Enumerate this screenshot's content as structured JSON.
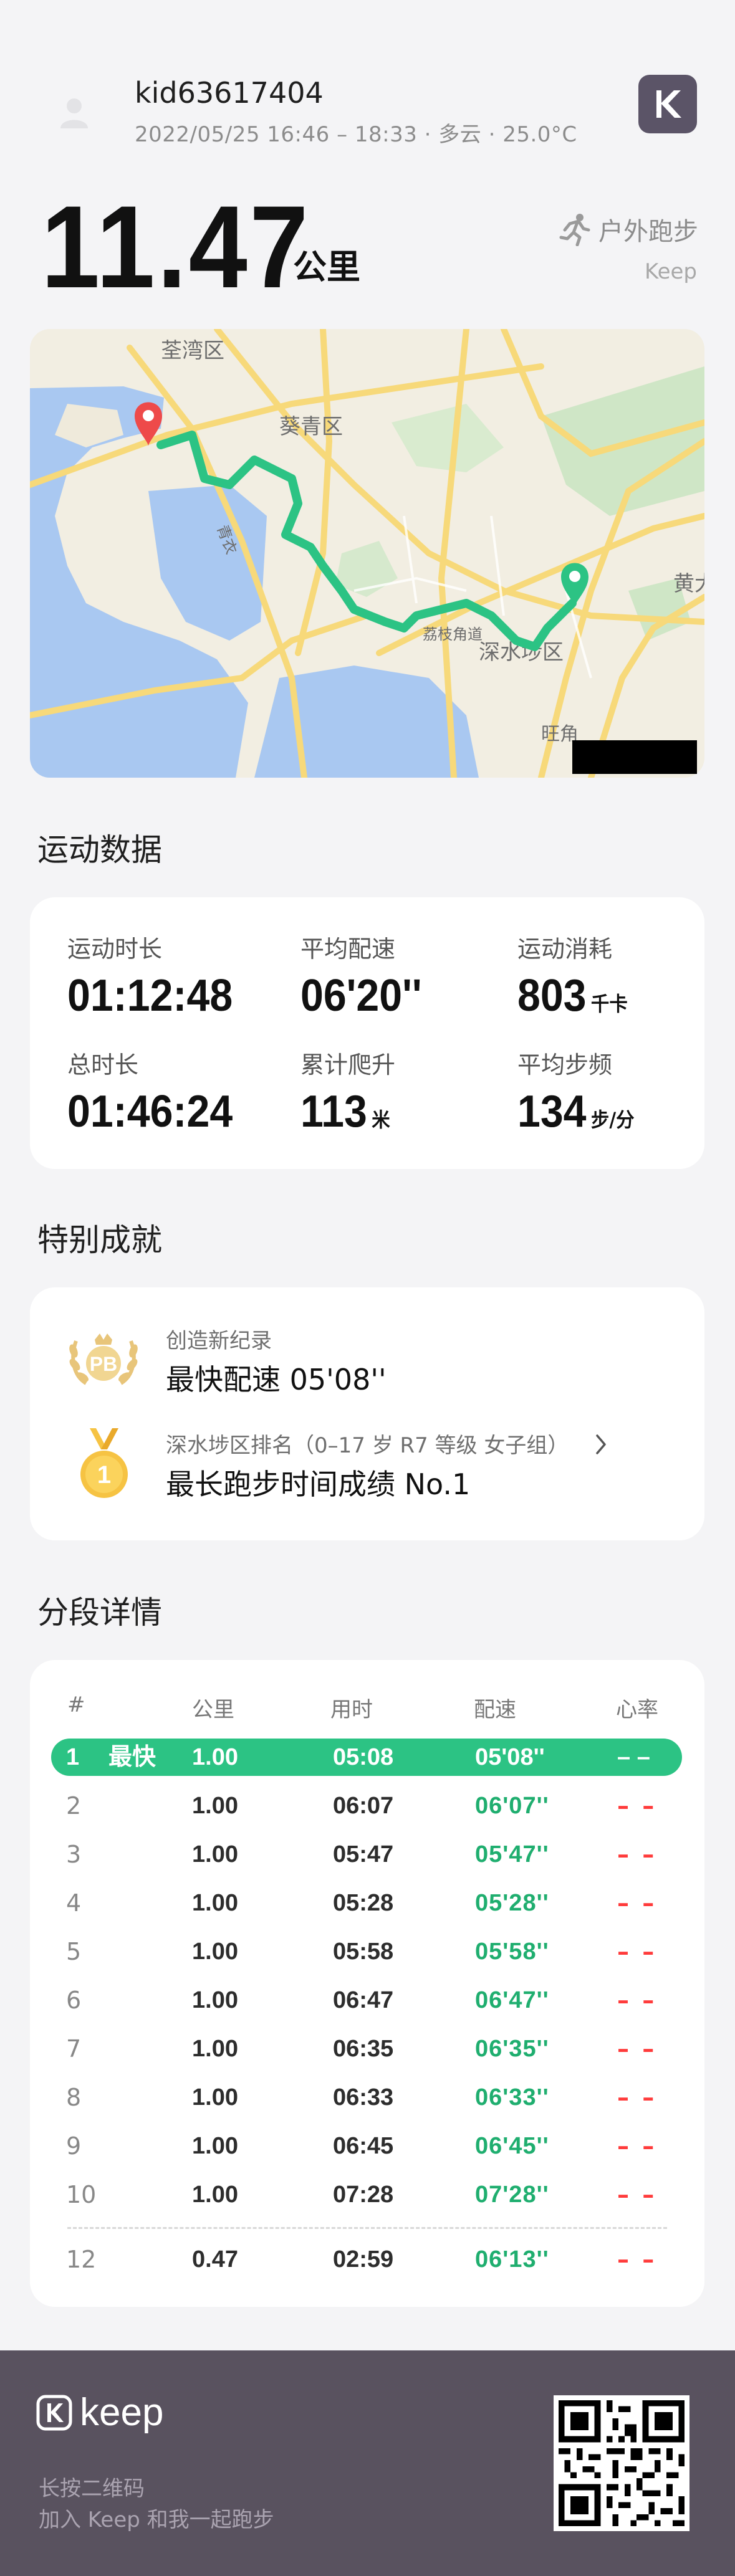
{
  "header": {
    "username": "kid63617404",
    "meta": "2022/05/25 16:46 – 18:33 · 多云 · 25.0°C",
    "logo_icon": "keep-k-logo-icon"
  },
  "summary": {
    "distance": "11.47",
    "distance_unit": "公里",
    "sport_type": "户外跑步",
    "brand": "Keep"
  },
  "map": {
    "labels": [
      "荃湾区",
      "葵青区",
      "黄大",
      "深水埗区",
      "旺角",
      "青衣",
      "荔枝角道"
    ],
    "route_color": "#2cc384",
    "start_pin_color": "#ee4a4a",
    "end_pin_color": "#2cc384"
  },
  "sections": {
    "stats_title": "运动数据",
    "achievements_title": "特别成就",
    "splits_title": "分段详情"
  },
  "stats": [
    {
      "label": "运动时长",
      "value": "01:12:48",
      "unit": ""
    },
    {
      "label": "平均配速",
      "value": "06'20''",
      "unit": ""
    },
    {
      "label": "运动消耗",
      "value": "803",
      "unit": "千卡"
    },
    {
      "label": "总时长",
      "value": "01:46:24",
      "unit": ""
    },
    {
      "label": "累计爬升",
      "value": "113",
      "unit": "米"
    },
    {
      "label": "平均步频",
      "value": "134",
      "unit": "步/分"
    }
  ],
  "achievements": [
    {
      "icon": "pb-laurel-icon",
      "badge_text": "PB",
      "sub": "创造新纪录",
      "main": "最快配速 05'08''"
    },
    {
      "icon": "gold-medal-icon",
      "badge_text": "1",
      "sub": "深水埗区排名（0–17 岁 R7 等级 女子组）",
      "main": "最长跑步时间成绩 No.1"
    }
  ],
  "splits": {
    "headers": [
      "#",
      "公里",
      "用时",
      "配速",
      "心率"
    ],
    "rows": [
      {
        "n": "1",
        "tag": "最快",
        "km": "1.00",
        "time": "05:08",
        "pace": "05'08''",
        "hr": "– –"
      },
      {
        "n": "2",
        "tag": "",
        "km": "1.00",
        "time": "06:07",
        "pace": "06'07''",
        "hr": "– –"
      },
      {
        "n": "3",
        "tag": "",
        "km": "1.00",
        "time": "05:47",
        "pace": "05'47''",
        "hr": "– –"
      },
      {
        "n": "4",
        "tag": "",
        "km": "1.00",
        "time": "05:28",
        "pace": "05'28''",
        "hr": "– –"
      },
      {
        "n": "5",
        "tag": "",
        "km": "1.00",
        "time": "05:58",
        "pace": "05'58''",
        "hr": "– –"
      },
      {
        "n": "6",
        "tag": "",
        "km": "1.00",
        "time": "06:47",
        "pace": "06'47''",
        "hr": "– –"
      },
      {
        "n": "7",
        "tag": "",
        "km": "1.00",
        "time": "06:35",
        "pace": "06'35''",
        "hr": "– –"
      },
      {
        "n": "8",
        "tag": "",
        "km": "1.00",
        "time": "06:33",
        "pace": "06'33''",
        "hr": "– –"
      },
      {
        "n": "9",
        "tag": "",
        "km": "1.00",
        "time": "06:45",
        "pace": "06'45''",
        "hr": "– –"
      },
      {
        "n": "10",
        "tag": "",
        "km": "1.00",
        "time": "07:28",
        "pace": "07'28''",
        "hr": "– –"
      },
      {
        "n": "12",
        "tag": "",
        "km": "0.47",
        "time": "02:59",
        "pace": "06'13''",
        "hr": "– –"
      }
    ]
  },
  "footer": {
    "brand": "keep",
    "line1": "长按二维码",
    "line2": "加入 Keep 和我一起跑步",
    "qr_icon": "qr-code-icon"
  }
}
